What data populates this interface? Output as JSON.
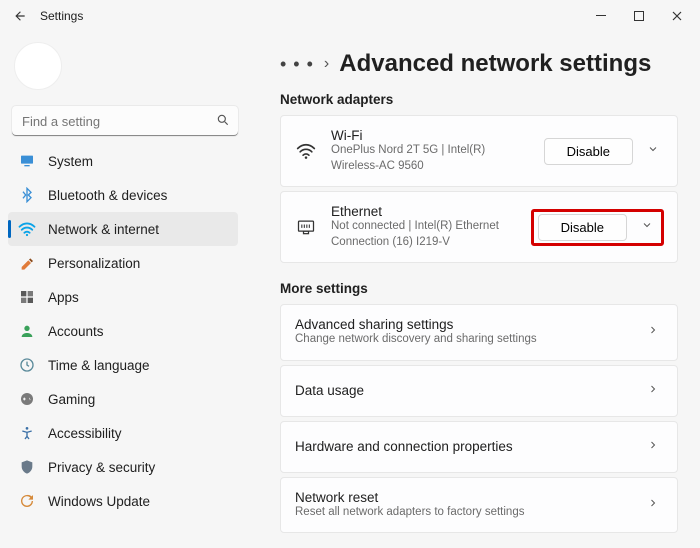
{
  "window": {
    "title": "Settings"
  },
  "search": {
    "placeholder": "Find a setting"
  },
  "nav": {
    "items": [
      {
        "label": "System"
      },
      {
        "label": "Bluetooth & devices"
      },
      {
        "label": "Network & internet"
      },
      {
        "label": "Personalization"
      },
      {
        "label": "Apps"
      },
      {
        "label": "Accounts"
      },
      {
        "label": "Time & language"
      },
      {
        "label": "Gaming"
      },
      {
        "label": "Accessibility"
      },
      {
        "label": "Privacy & security"
      },
      {
        "label": "Windows Update"
      }
    ]
  },
  "page": {
    "title": "Advanced network settings",
    "breadcrumb_chevron": "›",
    "section_adapters": "Network adapters",
    "section_more": "More settings"
  },
  "adapters": [
    {
      "name": "Wi-Fi",
      "detail": "OnePlus Nord 2T 5G | Intel(R) Wireless-AC 9560",
      "action": "Disable"
    },
    {
      "name": "Ethernet",
      "detail": "Not connected | Intel(R) Ethernet Connection (16) I219-V",
      "action": "Disable"
    }
  ],
  "more": [
    {
      "title": "Advanced sharing settings",
      "sub": "Change network discovery and sharing settings"
    },
    {
      "title": "Data usage",
      "sub": ""
    },
    {
      "title": "Hardware and connection properties",
      "sub": ""
    },
    {
      "title": "Network reset",
      "sub": "Reset all network adapters to factory settings"
    }
  ]
}
